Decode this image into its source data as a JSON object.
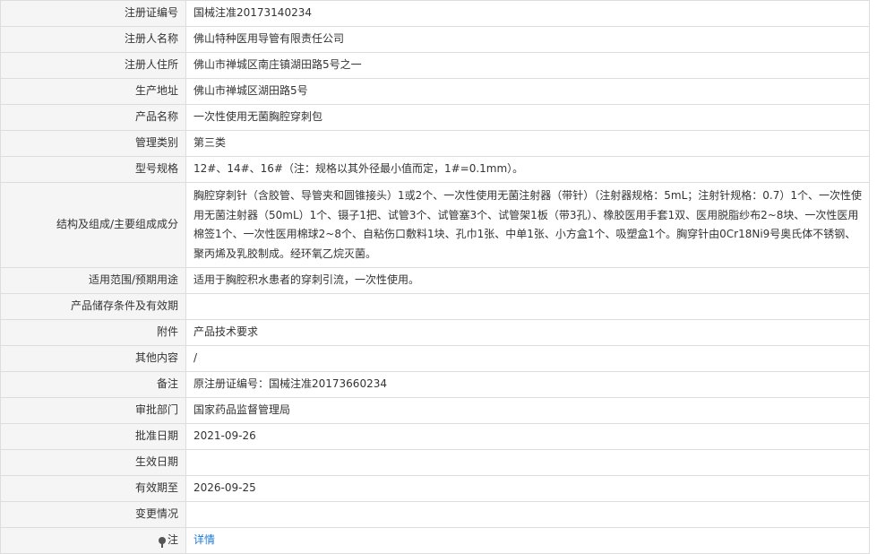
{
  "rows": [
    {
      "label": "注册证编号",
      "value": "国械注准20173140234"
    },
    {
      "label": "注册人名称",
      "value": "佛山特种医用导管有限责任公司"
    },
    {
      "label": "注册人住所",
      "value": "佛山市禅城区南庄镇湖田路5号之一"
    },
    {
      "label": "生产地址",
      "value": "佛山市禅城区湖田路5号"
    },
    {
      "label": "产品名称",
      "value": "一次性使用无菌胸腔穿刺包"
    },
    {
      "label": "管理类别",
      "value": "第三类"
    },
    {
      "label": "型号规格",
      "value": "12#、14#、16#（注：规格以其外径最小值而定，1#=0.1mm）。"
    },
    {
      "label": "结构及组成/主要组成成分",
      "value": "胸腔穿刺针（含胶管、导管夹和圆锥接头）1或2个、一次性使用无菌注射器（带针）（注射器规格：5mL；注射针规格：0.7）1个、一次性使用无菌注射器（50mL）1个、镊子1把、试管3个、试管塞3个、试管架1板（带3孔）、橡胶医用手套1双、医用脱脂纱布2~8块、一次性医用棉签1个、一次性医用棉球2~8个、自粘伤口敷料1块、孔巾1张、中单1张、小方盒1个、吸塑盒1个。胸穿针由0Cr18Ni9号奥氏体不锈钢、聚丙烯及乳胶制成。经环氧乙烷灭菌。"
    },
    {
      "label": "适用范围/预期用途",
      "value": "适用于胸腔积水患者的穿刺引流，一次性使用。"
    },
    {
      "label": "产品储存条件及有效期",
      "value": ""
    },
    {
      "label": "附件",
      "value": "产品技术要求"
    },
    {
      "label": "其他内容",
      "value": "/"
    },
    {
      "label": "备注",
      "value": "原注册证编号：国械注准20173660234"
    },
    {
      "label": "审批部门",
      "value": "国家药品监督管理局"
    },
    {
      "label": "批准日期",
      "value": "2021-09-26"
    },
    {
      "label": "生效日期",
      "value": ""
    },
    {
      "label": "有效期至",
      "value": "2026-09-25"
    },
    {
      "label": "变更情况",
      "value": ""
    },
    {
      "label": "注",
      "value": "详情",
      "icon": "location-pin-icon"
    }
  ],
  "colors": {
    "label_bg": "#f5f5f5",
    "border": "#dddddd",
    "link": "#1e7bd4"
  }
}
